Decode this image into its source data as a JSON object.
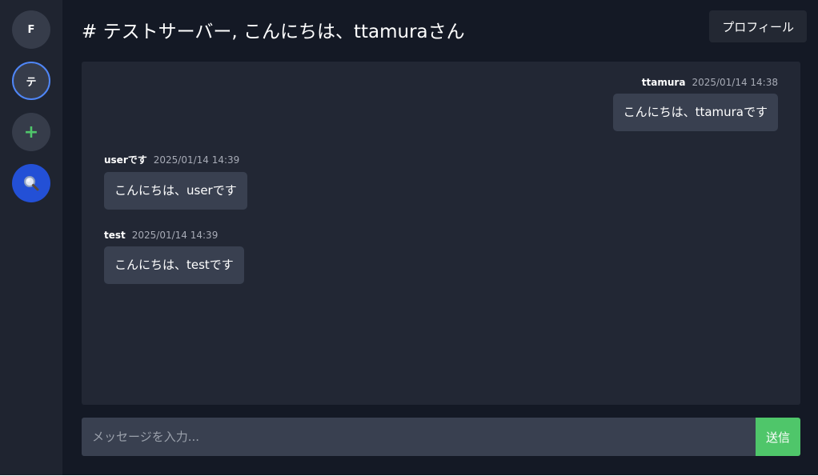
{
  "sidebar": {
    "servers": [
      {
        "label": "F"
      },
      {
        "label": "テ"
      }
    ],
    "add_label": "+",
    "search_icon": "magnifier-icon"
  },
  "header": {
    "title": "# テストサーバー, こんにちは、ttamuraさん",
    "profile_label": "プロフィール"
  },
  "messages": [
    {
      "author": "ttamura",
      "time": "2025/01/14 14:38",
      "text": "こんにちは、ttamuraです",
      "side": "right"
    },
    {
      "author": "userです",
      "time": "2025/01/14 14:39",
      "text": "こんにちは、userです",
      "side": "left"
    },
    {
      "author": "test",
      "time": "2025/01/14 14:39",
      "text": "こんにちは、testです",
      "side": "left"
    }
  ],
  "composer": {
    "placeholder": "メッセージを入力...",
    "value": "",
    "send_label": "送信"
  },
  "colors": {
    "accent_blue": "#4f86f7",
    "send_green": "#4fc66a",
    "search_blue": "#2350d6"
  }
}
